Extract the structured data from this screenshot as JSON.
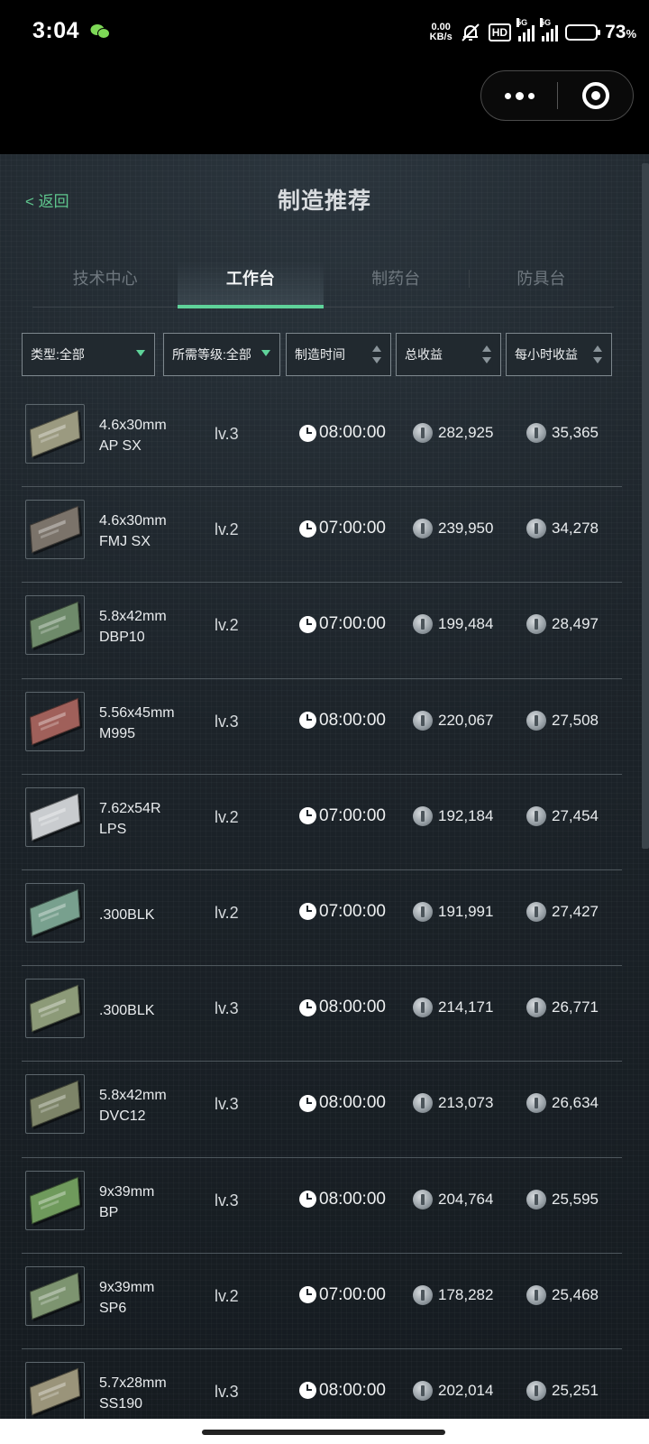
{
  "status_bar": {
    "time": "3:04",
    "net_speed_value": "0.00",
    "net_speed_unit": "KB/s",
    "hd_label": "HD",
    "sim1_tag": "5G",
    "sim2_tag": "5G",
    "battery_percent": "73",
    "battery_unit": "%"
  },
  "header": {
    "back_label": "< 返回",
    "title": "制造推荐"
  },
  "tabs": [
    {
      "label": "技术中心",
      "active": false
    },
    {
      "label": "工作台",
      "active": true
    },
    {
      "label": "制药台",
      "active": false
    },
    {
      "label": "防具台",
      "active": false
    }
  ],
  "filters": {
    "type": "类型:全部",
    "level": "所需等级:全部",
    "craft_time": "制造时间",
    "total_profit": "总收益",
    "hourly_profit": "每小时收益"
  },
  "items": [
    {
      "line1": "4.6x30mm",
      "line2": "AP SX",
      "level": "lv.3",
      "time": "08:00:00",
      "total": "282,925",
      "hourly": "35,365",
      "box_color": "#9b9a80"
    },
    {
      "line1": "4.6x30mm",
      "line2": "FMJ SX",
      "level": "lv.2",
      "time": "07:00:00",
      "total": "239,950",
      "hourly": "34,278",
      "box_color": "#7b736a"
    },
    {
      "line1": "5.8x42mm",
      "line2": "DBP10",
      "level": "lv.2",
      "time": "07:00:00",
      "total": "199,484",
      "hourly": "28,497",
      "box_color": "#6e8a6a"
    },
    {
      "line1": "5.56x45mm",
      "line2": "M995",
      "level": "lv.3",
      "time": "08:00:00",
      "total": "220,067",
      "hourly": "27,508",
      "box_color": "#a0605a"
    },
    {
      "line1": "7.62x54R",
      "line2": "LPS",
      "level": "lv.2",
      "time": "07:00:00",
      "total": "192,184",
      "hourly": "27,454",
      "box_color": "#c9cccf"
    },
    {
      "line1": ".300BLK",
      "line2": "",
      "level": "lv.2",
      "time": "07:00:00",
      "total": "191,991",
      "hourly": "27,427",
      "box_color": "#78a08e"
    },
    {
      "line1": ".300BLK",
      "line2": "",
      "level": "lv.3",
      "time": "08:00:00",
      "total": "214,171",
      "hourly": "26,771",
      "box_color": "#8c9a78"
    },
    {
      "line1": "5.8x42mm",
      "line2": "DVC12",
      "level": "lv.3",
      "time": "08:00:00",
      "total": "213,073",
      "hourly": "26,634",
      "box_color": "#7d8468"
    },
    {
      "line1": "9x39mm",
      "line2": "BP",
      "level": "lv.3",
      "time": "08:00:00",
      "total": "204,764",
      "hourly": "25,595",
      "box_color": "#6f9a5c"
    },
    {
      "line1": "9x39mm",
      "line2": "SP6",
      "level": "lv.2",
      "time": "07:00:00",
      "total": "178,282",
      "hourly": "25,468",
      "box_color": "#7d9470"
    },
    {
      "line1": "5.7x28mm",
      "line2": "SS190",
      "level": "lv.3",
      "time": "08:00:00",
      "total": "202,014",
      "hourly": "25,251",
      "box_color": "#9a947a"
    }
  ],
  "icons": {
    "clock": "clock-icon",
    "currency": "coin-icon",
    "more": "more-dots-icon",
    "close": "target-close-icon"
  },
  "colors": {
    "accent_green": "#5fd39a",
    "back_link": "#5fc78e"
  }
}
